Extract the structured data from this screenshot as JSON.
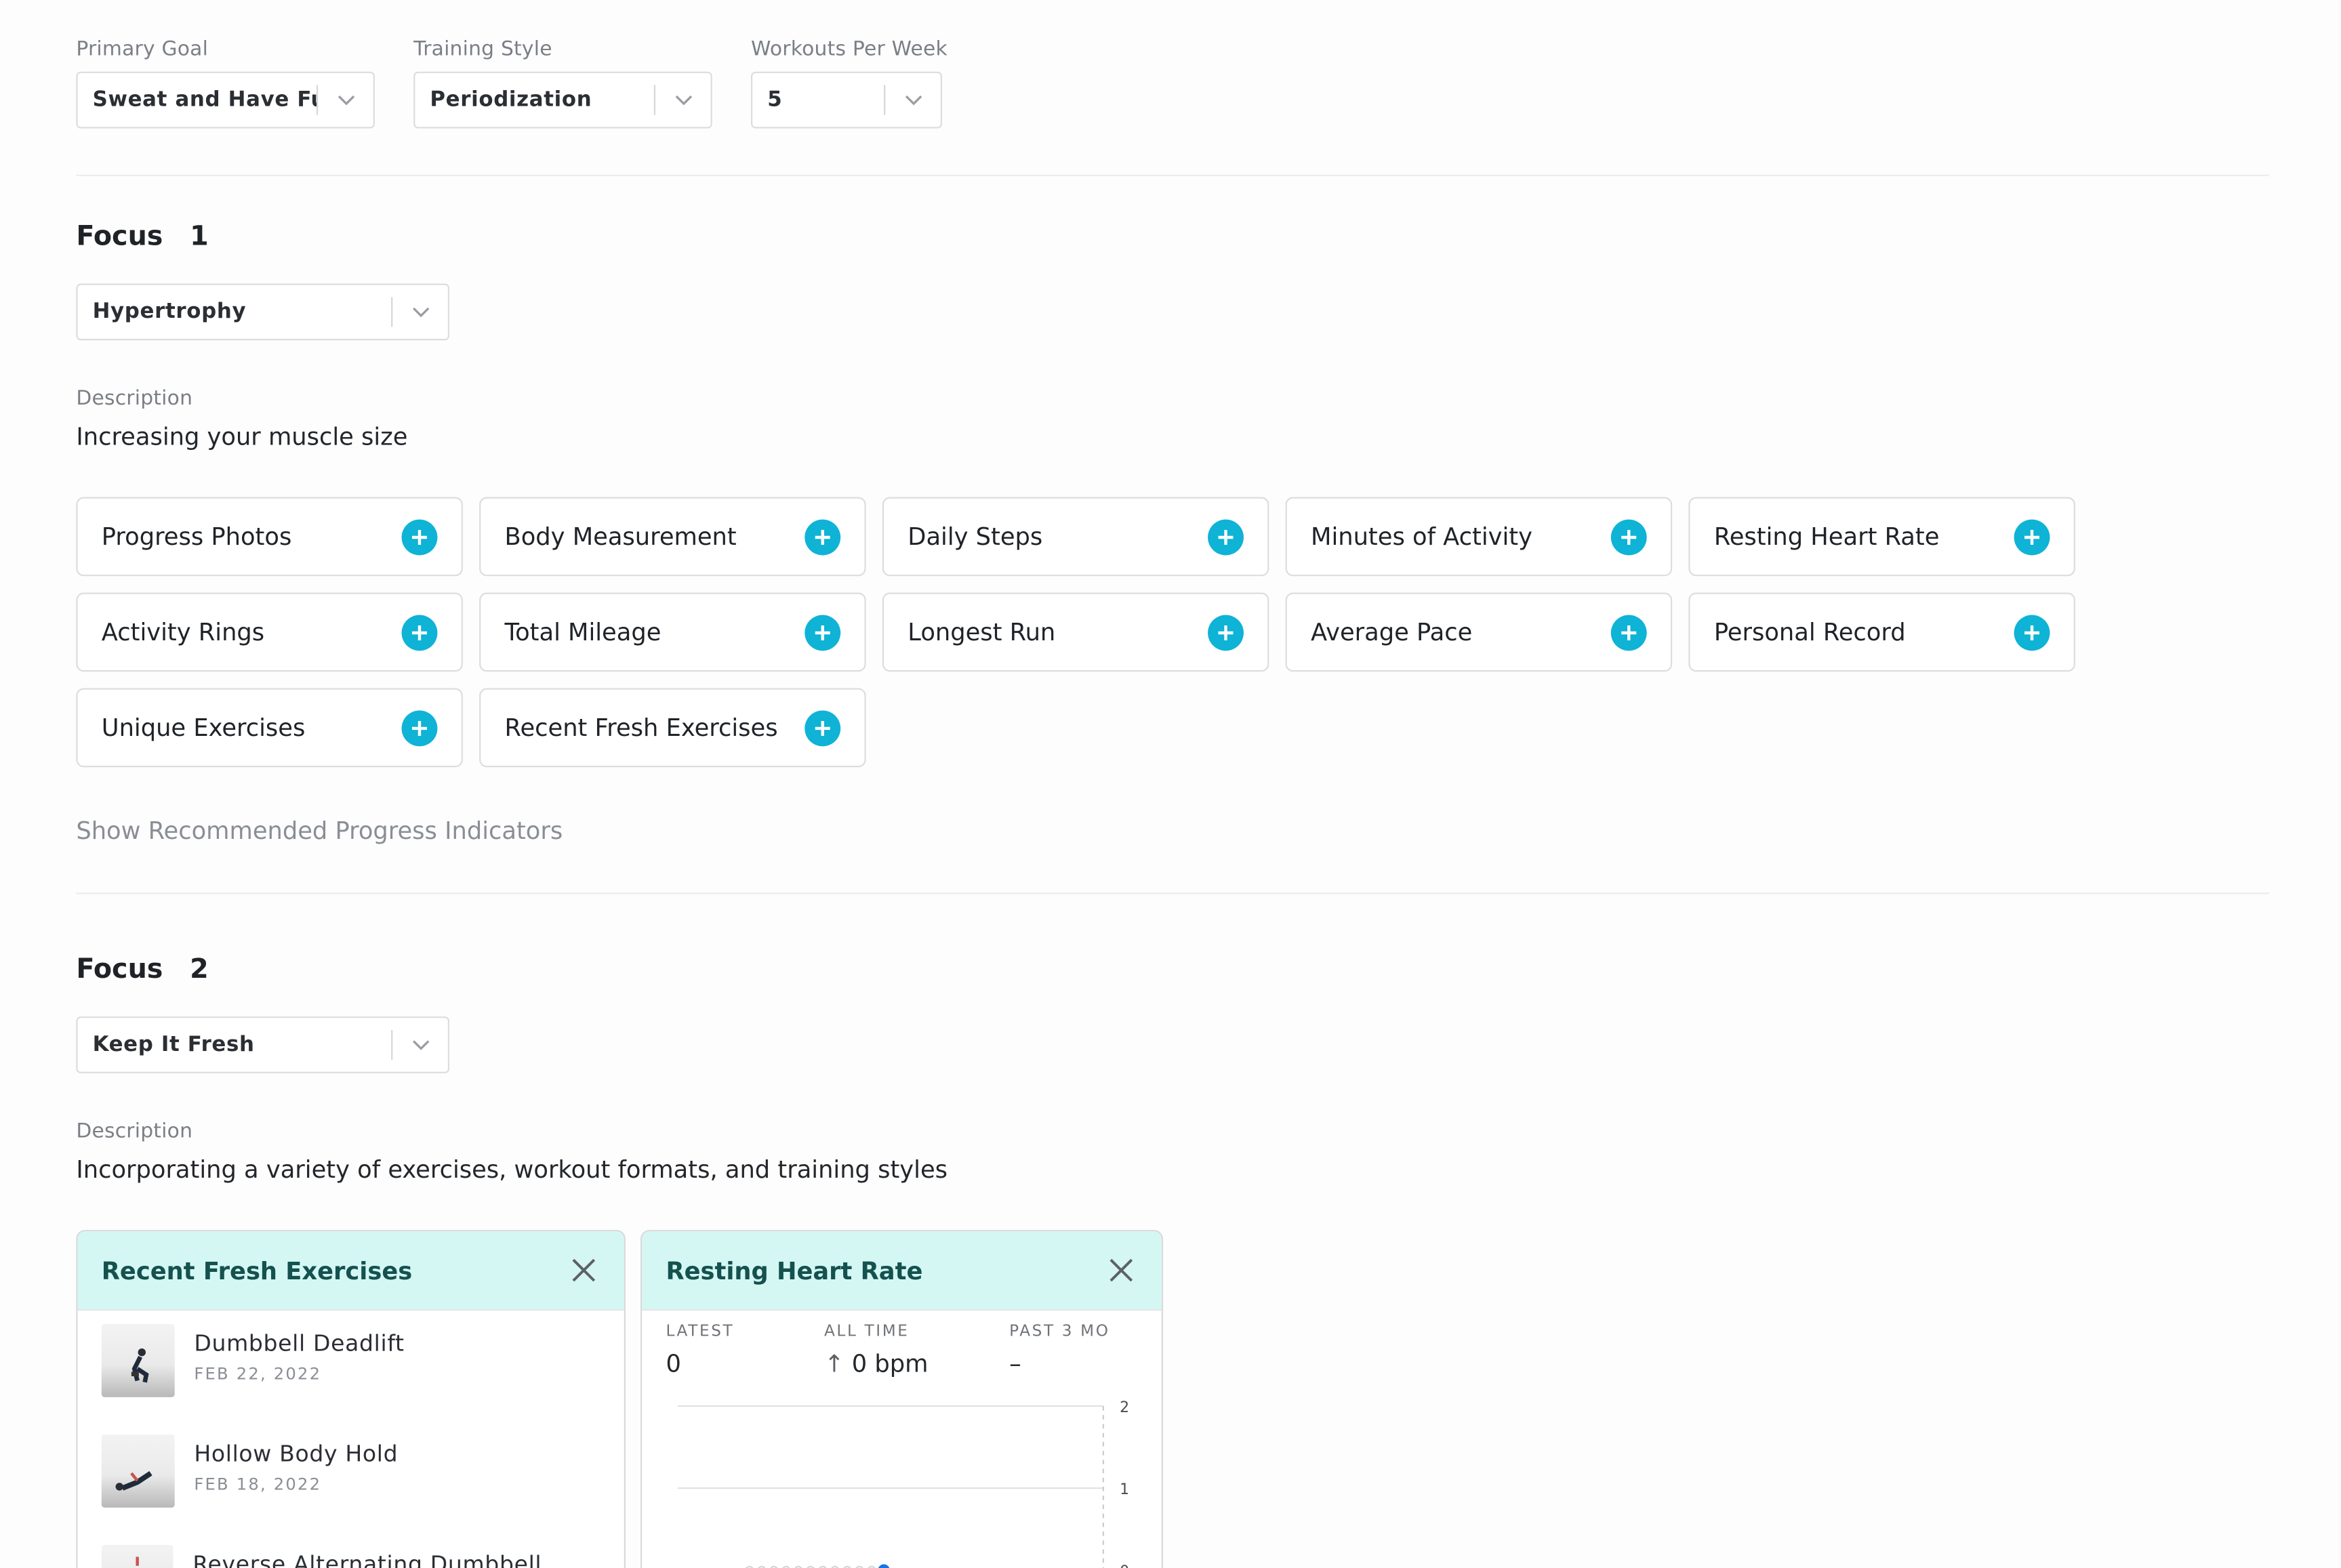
{
  "settings": {
    "primary_goal": {
      "label": "Primary Goal",
      "value": "Sweat and Have Fun"
    },
    "training_style": {
      "label": "Training Style",
      "value": "Periodization"
    },
    "workouts_per_week": {
      "label": "Workouts Per Week",
      "value": "5"
    }
  },
  "focus1": {
    "title": "Focus",
    "number": "1",
    "select_value": "Hypertrophy",
    "description_label": "Description",
    "description": "Increasing your muscle size",
    "indicators": [
      "Progress Photos",
      "Body Measurement",
      "Daily Steps",
      "Minutes of Activity",
      "Resting Heart Rate",
      "Activity Rings",
      "Total Mileage",
      "Longest Run",
      "Average Pace",
      "Personal Record",
      "Unique Exercises",
      "Recent Fresh Exercises"
    ],
    "show_recommended": "Show Recommended Progress Indicators"
  },
  "focus2": {
    "title": "Focus",
    "number": "2",
    "select_value": "Keep It Fresh",
    "description_label": "Description",
    "description": "Incorporating a variety of exercises, workout formats, and training styles"
  },
  "fresh_card": {
    "title": "Recent Fresh Exercises",
    "exercises": [
      {
        "name": "Dumbbell Deadlift",
        "date": "FEB 22, 2022"
      },
      {
        "name": "Hollow Body Hold",
        "date": "FEB 18, 2022"
      },
      {
        "name": "Reverse Alternating Dumbbell Lunges",
        "date": ""
      }
    ]
  },
  "heart_card": {
    "title": "Resting Heart Rate",
    "stats": [
      {
        "label": "LATEST",
        "value": "0"
      },
      {
        "label": "ALL TIME",
        "value": "0 bpm",
        "arrow": "↑"
      },
      {
        "label": "PAST 3 MO",
        "value": "–"
      }
    ],
    "y_ticks": [
      "2",
      "1",
      "0"
    ]
  },
  "chart_data": {
    "type": "line",
    "title": "",
    "ylim": [
      0,
      2
    ],
    "y_ticks": [
      0,
      1,
      2
    ],
    "series": [
      {
        "values": [
          0,
          0,
          0,
          0,
          0,
          0,
          0,
          0,
          0,
          0,
          0,
          0
        ]
      }
    ],
    "grid": true,
    "colors": {
      "line": "#d3d6da",
      "latest_point": "#1a73e8"
    }
  },
  "colors": {
    "accent": "#0eb3d6",
    "card_header": "#d4f7f4",
    "card_title": "#14514f"
  }
}
